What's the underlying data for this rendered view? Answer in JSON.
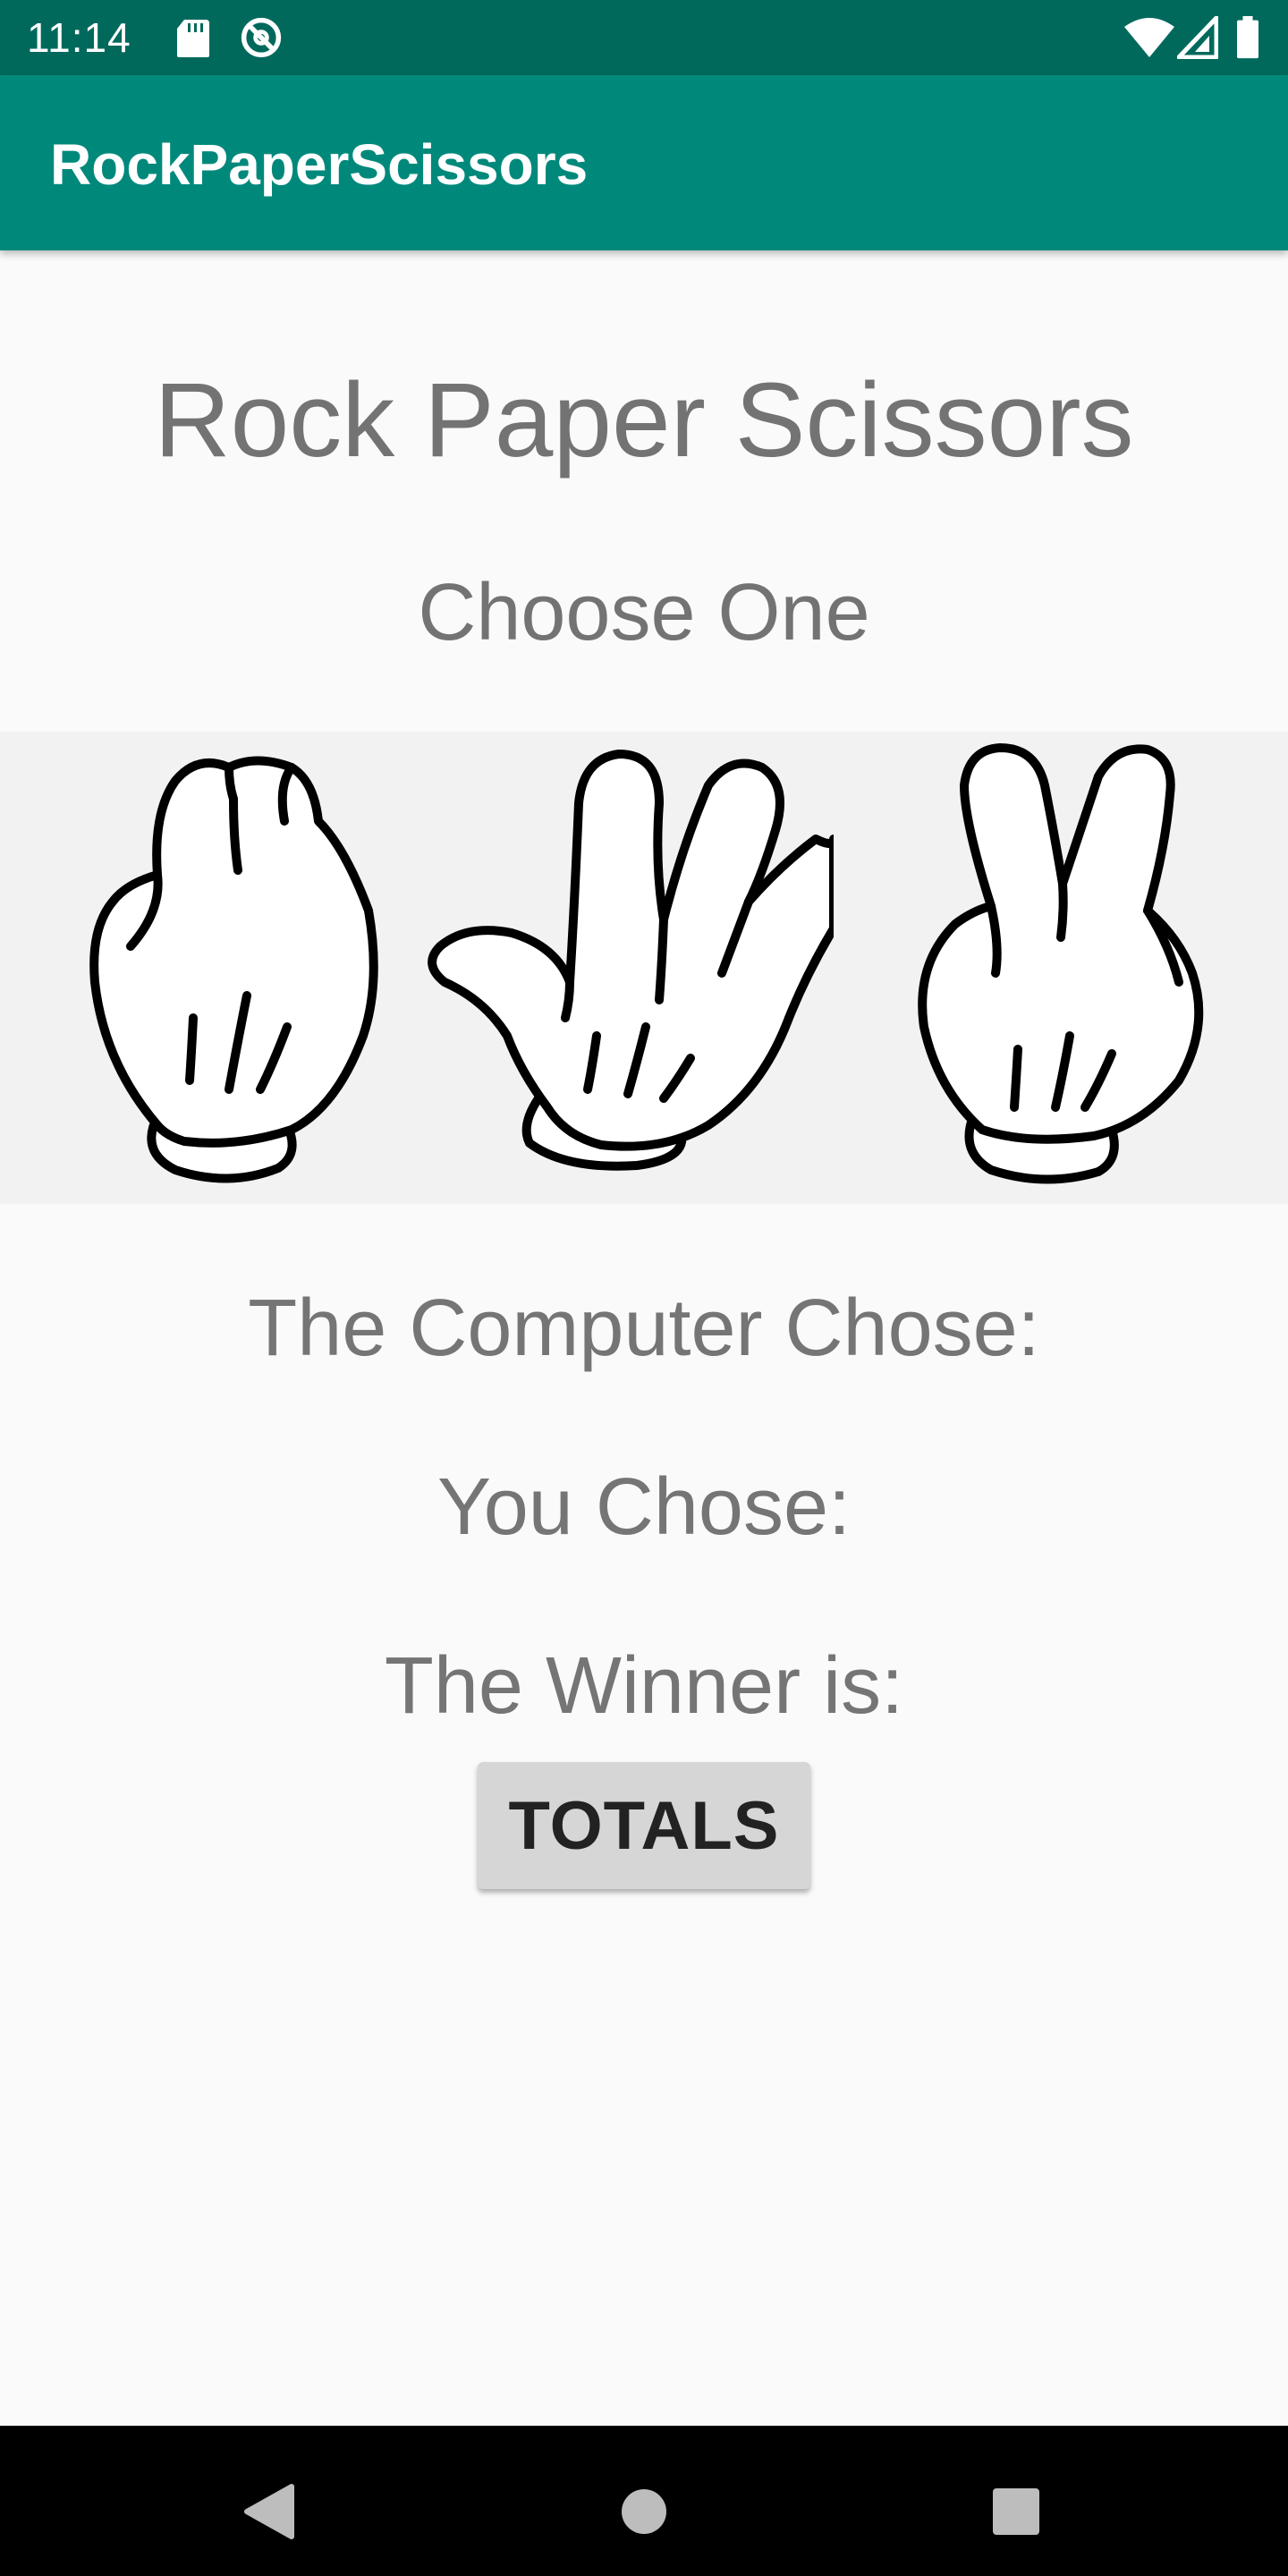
{
  "status_bar": {
    "time": "11:14",
    "icons": [
      "sd-card-icon",
      "no-data-icon",
      "wifi-icon",
      "signal-icon",
      "battery-icon"
    ]
  },
  "app_bar": {
    "title": "RockPaperScissors"
  },
  "main": {
    "title": "Rock Paper Scissors",
    "prompt": "Choose One",
    "choices": [
      "rock-hand-icon",
      "paper-hand-icon",
      "scissors-hand-icon"
    ],
    "computer_chose_label": "The Computer Chose:",
    "you_chose_label": "You Chose:",
    "winner_label": "The Winner is:",
    "totals_button": "TOTALS"
  },
  "nav_bar": {
    "buttons": [
      "back-icon",
      "home-icon",
      "recents-icon"
    ]
  },
  "colors": {
    "status_bar": "#00695c",
    "app_bar": "#00897b",
    "text_gray": "#757575",
    "button_gray": "#d6d6d6"
  }
}
